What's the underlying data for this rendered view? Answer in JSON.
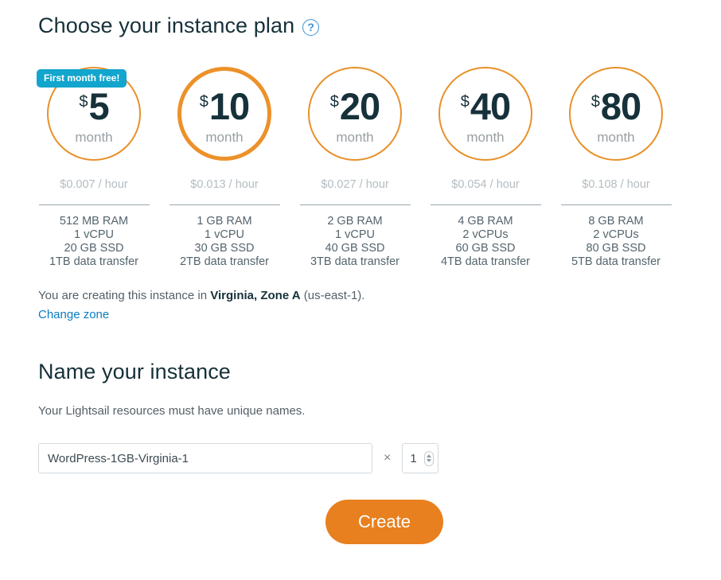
{
  "plans_section": {
    "heading": "Choose your instance plan",
    "help_icon": "question-mark-icon",
    "badge_color": "#12a5cd",
    "accent_color": "#e8912a",
    "plans": [
      {
        "currency": "$",
        "amount": "5",
        "period": "month",
        "hourly": "$0.007 / hour",
        "badge": "First month free!",
        "ram": "512 MB RAM",
        "cpu": "1 vCPU",
        "ssd": "20 GB SSD",
        "transfer": "1TB data transfer",
        "selected": false
      },
      {
        "currency": "$",
        "amount": "10",
        "period": "month",
        "hourly": "$0.013 / hour",
        "badge": "",
        "ram": "1 GB RAM",
        "cpu": "1 vCPU",
        "ssd": "30 GB SSD",
        "transfer": "2TB data transfer",
        "selected": true
      },
      {
        "currency": "$",
        "amount": "20",
        "period": "month",
        "hourly": "$0.027 / hour",
        "badge": "",
        "ram": "2 GB RAM",
        "cpu": "1 vCPU",
        "ssd": "40 GB SSD",
        "transfer": "3TB data transfer",
        "selected": false
      },
      {
        "currency": "$",
        "amount": "40",
        "period": "month",
        "hourly": "$0.054 / hour",
        "badge": "",
        "ram": "4 GB RAM",
        "cpu": "2 vCPUs",
        "ssd": "60 GB SSD",
        "transfer": "4TB data transfer",
        "selected": false
      },
      {
        "currency": "$",
        "amount": "80",
        "period": "month",
        "hourly": "$0.108 / hour",
        "badge": "",
        "ram": "8 GB RAM",
        "cpu": "2 vCPUs",
        "ssd": "80 GB SSD",
        "transfer": "5TB data transfer",
        "selected": false
      }
    ]
  },
  "zone": {
    "prefix": "You are creating this instance in ",
    "region": "Virginia, Zone A",
    "suffix": " (us-east-1).",
    "change_link": "Change zone",
    "link_color": "#0a7dc4"
  },
  "name_section": {
    "heading": "Name your instance",
    "description": "Your Lightsail resources must have unique names.",
    "input_value": "WordPress-1GB-Virginia-1",
    "input_placeholder": "Instance name",
    "multiplier_symbol": "×",
    "quantity": "1"
  },
  "actions": {
    "create_label": "Create",
    "create_color": "#e8801f"
  }
}
